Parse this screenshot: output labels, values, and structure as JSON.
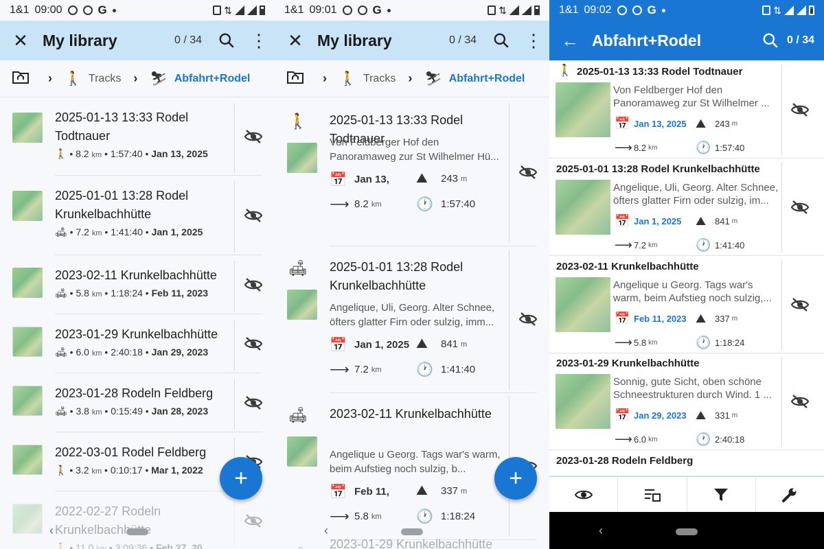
{
  "status": [
    {
      "carrier": "1&1",
      "time": "09:00"
    },
    {
      "carrier": "1&1",
      "time": "09:01"
    },
    {
      "carrier": "1&1",
      "time": "09:02"
    }
  ],
  "screen1": {
    "title": "My library",
    "counter": "0 / 34",
    "breadcrumb": {
      "tracks": "Tracks",
      "current": "Abfahrt+Rodel"
    },
    "items": [
      {
        "name": "2025-01-13 13:33 Rodel Todtnauer",
        "icon": "hiking-icon",
        "dist": "8.2",
        "dur": "1:57:40",
        "date": "Jan 13, 2025"
      },
      {
        "name": "2025-01-01 13:28 Rodel Krunkelbachhütte",
        "icon": "sofa-icon",
        "dist": "7.2",
        "dur": "1:41:40",
        "date": "Jan 1, 2025"
      },
      {
        "name": "2023-02-11 Krunkelbachhütte",
        "icon": "sofa-icon",
        "dist": "5.8",
        "dur": "1:18:24",
        "date": "Feb 11, 2023"
      },
      {
        "name": "2023-01-29 Krunkelbachhütte",
        "icon": "sofa-icon",
        "dist": "6.0",
        "dur": "2:40:18",
        "date": "Jan 29, 2023"
      },
      {
        "name": "2023-01-28 Rodeln Feldberg",
        "icon": "sofa-icon",
        "dist": "3.8",
        "dur": "0:15:49",
        "date": "Jan 28, 2023"
      },
      {
        "name": "2022-03-01 Rodel Feldberg",
        "icon": "hiking-icon",
        "dist": "3.2",
        "dur": "0:10:17",
        "date": "Mar 1, 2022"
      },
      {
        "name": "2022-02-27 Rodeln Krunkelbachhütte",
        "icon": "hiking-icon",
        "dist": "11.0",
        "dur": "3:09:36",
        "date": "Feb 27, 20..."
      }
    ],
    "unit": "km"
  },
  "screen2": {
    "title": "My library",
    "counter": "0 / 34",
    "breadcrumb": {
      "tracks": "Tracks",
      "current": "Abfahrt+Rodel"
    },
    "items": [
      {
        "name": "2025-01-13 13:33 Rodel Todtnauer",
        "desc": "Von Feldberger Hof den Panoramaweg zur St Wilhelmer Hü...",
        "date": "Jan 13,",
        "elev": "243",
        "dist": "8.2",
        "dur": "1:57:40"
      },
      {
        "name": "2025-01-01 13:28 Rodel Krunkelbachhütte",
        "desc": "Angelique, Uli, Georg. Alter Schnee, öfters glatter Firn oder sulzig, imm...",
        "date": "Jan 1, 2025",
        "elev": "841",
        "dist": "7.2",
        "dur": "1:41:40"
      },
      {
        "name": "2023-02-11 Krunkelbachhütte",
        "desc": "Angelique u Georg. Tags war's warm, beim Aufstieg noch sulzig, b...",
        "date": "Feb 11,",
        "elev": "337",
        "dist": "5.8",
        "dur": "1:18:24"
      },
      {
        "name": "2023-01-29 Krunkelbachhütte"
      }
    ],
    "unit_km": "km",
    "unit_m": "m"
  },
  "screen3": {
    "title": "Abfahrt+Rodel",
    "counter": "0 / 34",
    "items": [
      {
        "name": "2025-01-13 13:33 Rodel Todtnauer",
        "desc": "Von Feldberger Hof den Panoramaweg zur St Wilhelmer ...",
        "date": "Jan 13, 2025",
        "elev": "243",
        "dist": "8.2",
        "dur": "1:57:40"
      },
      {
        "name": "2025-01-01 13:28 Rodel Krunkelbachhütte",
        "desc": "Angelique, Uli, Georg. Alter Schnee, öfters glatter Firn oder sulzig, im...",
        "date": "Jan 1, 2025",
        "elev": "841",
        "dist": "7.2",
        "dur": "1:41:40"
      },
      {
        "name": "2023-02-11 Krunkelbachhütte",
        "desc": "Angelique u Georg. Tags war's warm, beim Aufstieg noch sulzig,...",
        "date": "Feb 11, 2023",
        "elev": "337",
        "dist": "5.8",
        "dur": "1:18:24"
      },
      {
        "name": "2023-01-29 Krunkelbachhütte",
        "desc": "Sonnig, gute Sicht, oben schöne Schneestrukturen durch Wind. 1 ...",
        "date": "Jan 29, 2023",
        "elev": "331",
        "dist": "6.0",
        "dur": "2:40:18"
      },
      {
        "name": "2023-01-28 Rodeln Feldberg"
      }
    ],
    "unit_km": "km",
    "unit_m": "m"
  },
  "colors": {
    "accent": "#1976d2",
    "appbar_light": "#c9e3f7"
  }
}
